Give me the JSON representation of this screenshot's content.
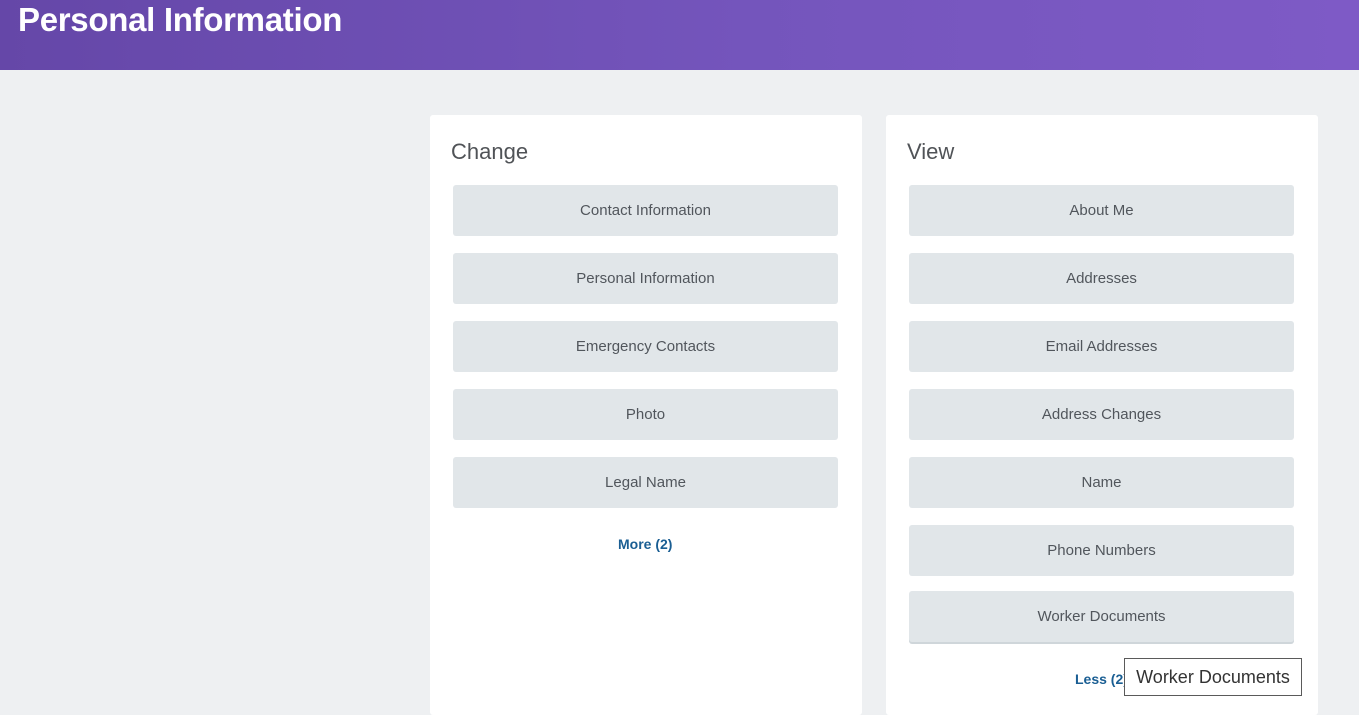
{
  "header": {
    "title": "Personal Information"
  },
  "change": {
    "title": "Change",
    "items": [
      "Contact Information",
      "Personal Information",
      "Emergency Contacts",
      "Photo",
      "Legal Name"
    ],
    "more_label": "More (2)"
  },
  "view": {
    "title": "View",
    "items": [
      "About Me",
      "Addresses",
      "Email Addresses",
      "Address Changes",
      "Name",
      "Phone Numbers",
      "Worker Documents"
    ],
    "less_label": "Less (2)"
  },
  "tooltip": {
    "text": "Worker Documents"
  }
}
